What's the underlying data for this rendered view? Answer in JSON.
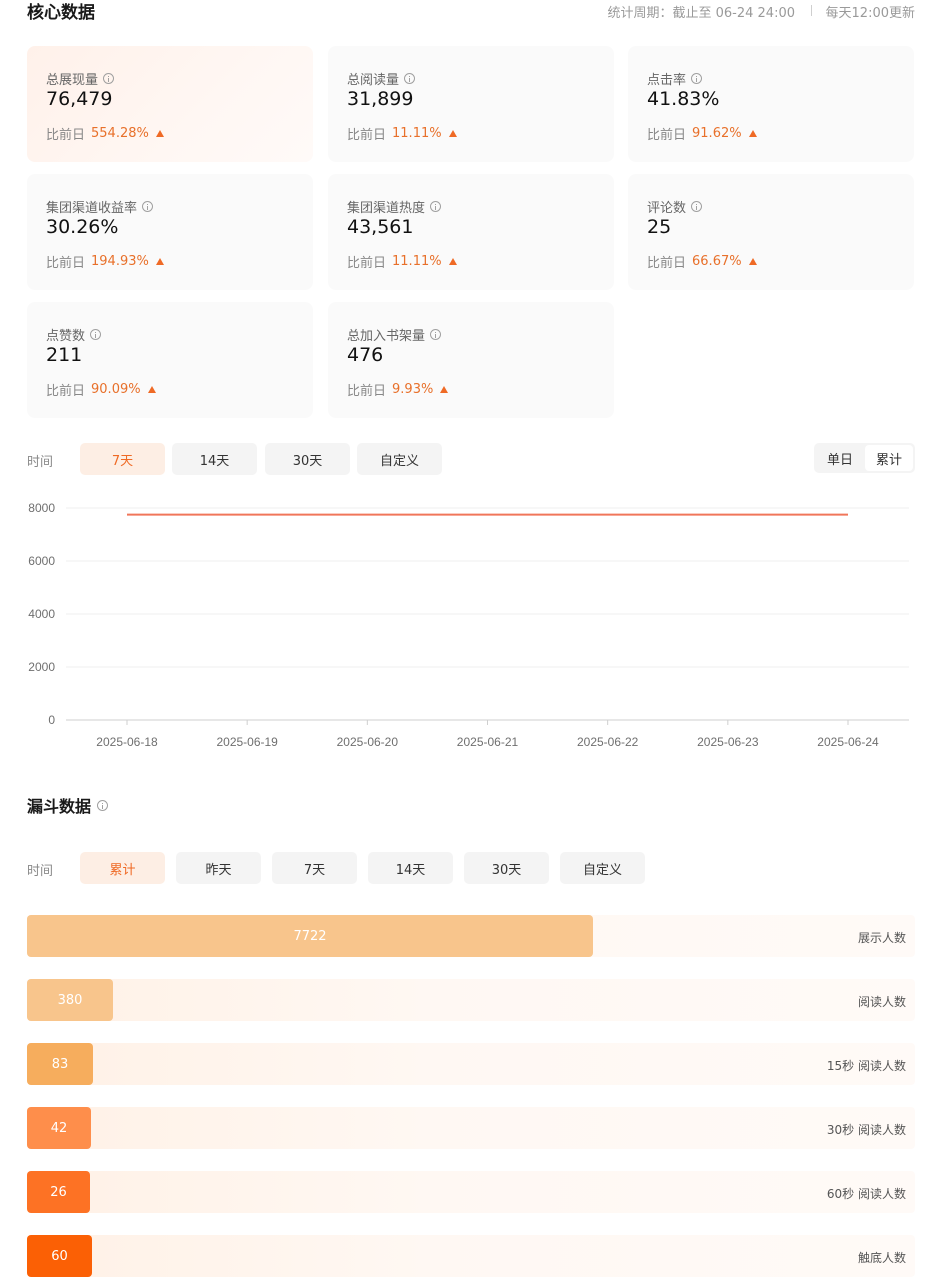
{
  "header": {
    "title": "核心数据",
    "period": "统计周期：截止至 06-24 24:00",
    "update": "每天12:00更新"
  },
  "cards": [
    {
      "label": "总展现量",
      "value": "76,479",
      "compare_label": "比前日",
      "change": "554.28%"
    },
    {
      "label": "总阅读量",
      "value": "31,899",
      "compare_label": "比前日",
      "change": "11.11%"
    },
    {
      "label": "点击率",
      "value": "41.83%",
      "compare_label": "比前日",
      "change": "91.62%"
    },
    {
      "label": "集团渠道收益率",
      "value": "30.26%",
      "compare_label": "比前日",
      "change": "194.93%"
    },
    {
      "label": "集团渠道热度",
      "value": "43,561",
      "compare_label": "比前日",
      "change": "11.11%"
    },
    {
      "label": "评论数",
      "value": "25",
      "compare_label": "比前日",
      "change": "66.67%"
    },
    {
      "label": "点赞数",
      "value": "211",
      "compare_label": "比前日",
      "change": "90.09%"
    },
    {
      "label": "总加入书架量",
      "value": "476",
      "compare_label": "比前日",
      "change": "9.93%"
    }
  ],
  "trend_filter": {
    "label": "时间",
    "chips": [
      "7天",
      "14天",
      "30天",
      "自定义"
    ],
    "active": "7天",
    "toggle": [
      "单日",
      "累计"
    ],
    "toggle_selected": "累计"
  },
  "chart_data": {
    "type": "line",
    "x": [
      "2025-06-18",
      "2025-06-19",
      "2025-06-20",
      "2025-06-21",
      "2025-06-22",
      "2025-06-23",
      "2025-06-24"
    ],
    "series": [
      {
        "values": [
          7750,
          7750,
          7750,
          7750,
          7750,
          7750,
          7750
        ],
        "color": "#f0765a"
      }
    ],
    "y_ticks": [
      0,
      2000,
      4000,
      6000,
      8000
    ],
    "ylim": [
      0,
      8000
    ],
    "grid": true
  },
  "funnel": {
    "title": "漏斗数据",
    "filter_label": "时间",
    "chips": [
      "累计",
      "昨天",
      "7天",
      "14天",
      "30天",
      "自定义"
    ],
    "active": "累计",
    "rows": [
      {
        "value": 7722,
        "label": "展示人数",
        "color": "#f8c58c"
      },
      {
        "value": 380,
        "label": "阅读人数",
        "color": "#f8c58c"
      },
      {
        "value": 83,
        "label": "15秒 阅读人数",
        "color": "#f6ad5d"
      },
      {
        "value": 42,
        "label": "30秒 阅读人数",
        "color": "#fe8e4b"
      },
      {
        "value": 26,
        "label": "60秒 阅读人数",
        "color": "#fd7224"
      },
      {
        "value": 60,
        "label": "触底人数",
        "color": "#fb6005"
      }
    ]
  }
}
